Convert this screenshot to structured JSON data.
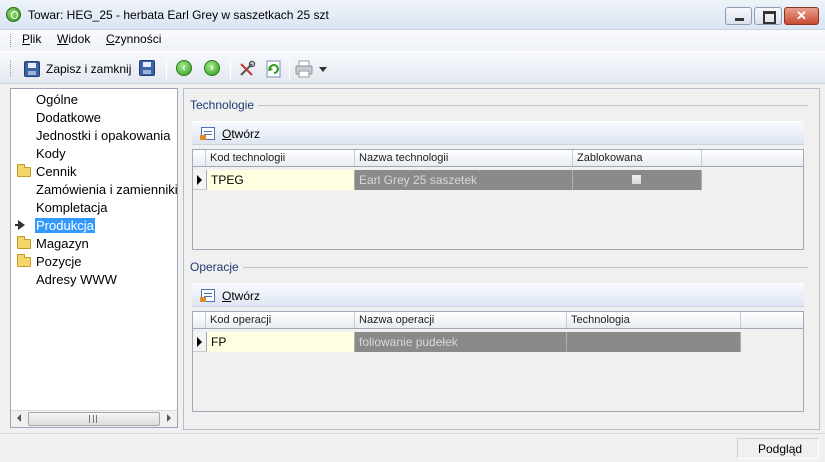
{
  "window": {
    "title": "Towar: HEG_25 - herbata Earl Grey w saszetkach 25 szt"
  },
  "menu": {
    "items": [
      {
        "u": "P",
        "rest": "lik"
      },
      {
        "u": "W",
        "rest": "idok"
      },
      {
        "u": "C",
        "rest": "zynności"
      }
    ]
  },
  "toolbar": {
    "save_close_label": "Zapisz i zamknij",
    "icons": [
      "save-close-icon",
      "save-icon",
      "back-icon",
      "forward-icon",
      "tools-icon",
      "refresh-icon",
      "print-icon",
      "dropdown-arrow-icon"
    ]
  },
  "sidebar": {
    "items": [
      {
        "label": "Ogólne",
        "icon": "none"
      },
      {
        "label": "Dodatkowe",
        "icon": "none"
      },
      {
        "label": "Jednostki i opakowania",
        "icon": "none"
      },
      {
        "label": "Kody",
        "icon": "none"
      },
      {
        "label": "Cennik",
        "icon": "folder-icon"
      },
      {
        "label": "Zamówienia i zamienniki",
        "icon": "none"
      },
      {
        "label": "Kompletacja",
        "icon": "none"
      },
      {
        "label": "Produkcja",
        "icon": "current-arrow-icon",
        "selected": true
      },
      {
        "label": "Magazyn",
        "icon": "folder-icon"
      },
      {
        "label": "Pozycje",
        "icon": "folder-icon"
      },
      {
        "label": "Adresy WWW",
        "icon": "none"
      }
    ],
    "scroll_grip": "III"
  },
  "technologie": {
    "group_title": "Technologie",
    "open_u": "O",
    "open_rest": "twórz",
    "columns": [
      "Kod technologii",
      "Nazwa technologii",
      "Zablokowana"
    ],
    "rows": [
      {
        "kod": "TPEG",
        "nazwa": "Earl Grey 25 saszetek",
        "zablokowana": false
      }
    ]
  },
  "operacje": {
    "group_title": "Operacje",
    "open_u": "O",
    "open_rest": "twórz",
    "columns": [
      "Kod operacji",
      "Nazwa operacji",
      "Technologia"
    ],
    "rows": [
      {
        "kod": "FP",
        "nazwa": "foliowanie pudełek",
        "technologia": ""
      }
    ]
  },
  "statusbar": {
    "text": "Podgląd"
  }
}
